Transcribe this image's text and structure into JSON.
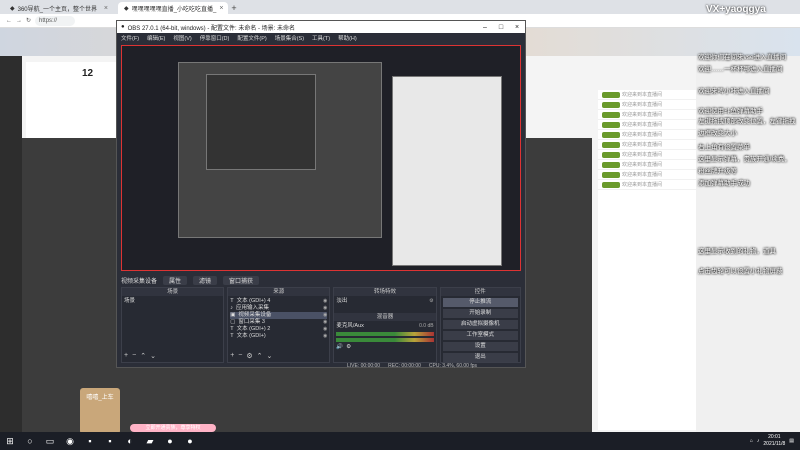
{
  "browser": {
    "tabs": [
      {
        "label": "360导航_一个主页，整个世界",
        "active": false
      },
      {
        "label": "嘿嘿嘿嘿嘿直播_小吃吃吃直播_",
        "active": true
      }
    ],
    "url": "https://"
  },
  "room": {
    "number": "12"
  },
  "watermark": "VX+yaoqgya",
  "overlay_messages": [
    "欢迎你们在间来vse进入直播间",
    "欢迎……一杯杯哪进入直播间",
    "欢迎来啤小咔进入直播间",
    "欢迎使用斗鱼弹幕助手",
    "左键拖拽顶部改变位置，左键拖拽",
    "边框改变大小",
    "右上角有设置菜单",
    "这里显示弹幕，贵族开通/续费，",
    "粉丝牌升级等",
    "添加弹幕助手成功",
    "这里显示收到的礼物，道具",
    "点击齿轮可以设置小礼物屏蔽"
  ],
  "obs": {
    "title": "OBS 27.0.1 (64-bit, windows) - 配置文件: 未命名 - 场景: 未命名",
    "menu": [
      "文件(F)",
      "编辑(E)",
      "视图(V)",
      "停靠窗口(D)",
      "配置文件(P)",
      "场景集合(S)",
      "工具(T)",
      "帮助(H)"
    ],
    "toolbar": {
      "label": "视频采集设备",
      "props": "属性",
      "filters": "滤镜",
      "interact": "窗口捕获"
    },
    "docks": {
      "scenes": {
        "title": "场景",
        "items": [
          "场景"
        ]
      },
      "sources": {
        "title": "来源",
        "items": [
          "文本 (GDI+) 4",
          "应用输入采集",
          "视频采集设备",
          "窗口采集 3",
          "文本 (GDI+) 2",
          "文本 (GDI+)"
        ]
      },
      "transitions": {
        "title": "转场特效",
        "value": "淡出"
      },
      "mixer": {
        "title": "混音器",
        "channel": "麦克风/Aux",
        "db": "0.0 dB"
      },
      "controls": {
        "title": "控件",
        "buttons": [
          "停止推流",
          "开始录制",
          "启动虚拟摄像机",
          "工作室模式",
          "设置",
          "退出"
        ]
      }
    },
    "status": {
      "live": "LIVE: 00:00:00",
      "rec": "REC: 00:00:00",
      "cpu": "CPU: 3.4%, 60.00 fps"
    }
  },
  "taskbar": {
    "time": "20:01",
    "date": "2021/11/8"
  },
  "gift_label": "嘻嘻_上车",
  "pink_bar": "立即开通贵族，尊享特权"
}
